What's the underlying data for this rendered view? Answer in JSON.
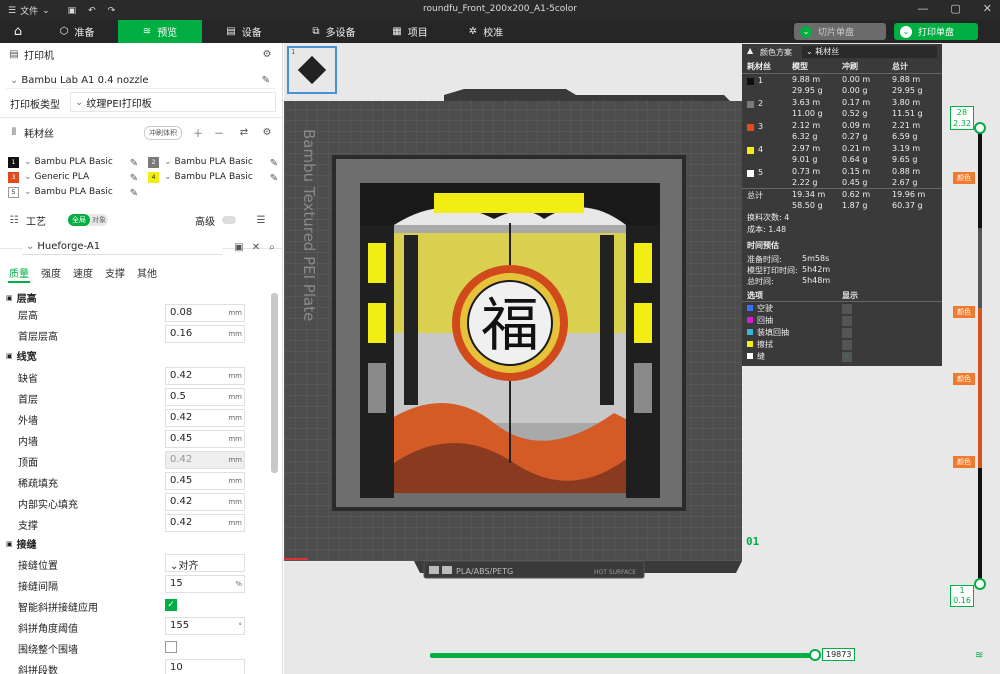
{
  "window": {
    "menu": "文件",
    "title": "roundfu_Front_200x200_A1-5color"
  },
  "tabs": {
    "prepare": "准备",
    "preview": "预览",
    "device": "设备",
    "multi_device": "多设备",
    "project": "项目",
    "calibrate": "校准"
  },
  "actions": {
    "slice": "切片单盘",
    "print": "打印单盘"
  },
  "printer": {
    "header": "打印机",
    "model": "Bambu Lab A1 0.4 nozzle",
    "plate_label": "打印板类型",
    "plate_value": "纹理PEI打印板"
  },
  "filament": {
    "header": "耗材丝",
    "flush_btn": "冲刷体积",
    "items": [
      {
        "num": "1",
        "name": "Bambu PLA Basic",
        "color": "#111111"
      },
      {
        "num": "2",
        "name": "Bambu PLA Basic",
        "color": "#7a7a7a"
      },
      {
        "num": "3",
        "name": "Generic PLA",
        "color": "#e24a1c"
      },
      {
        "num": "4",
        "name": "Bambu PLA Basic",
        "color": "#f2ee14"
      },
      {
        "num": "5",
        "name": "Bambu PLA Basic",
        "color": "#ffffff"
      }
    ]
  },
  "process": {
    "header": "工艺",
    "global": "全局",
    "object": "对象",
    "advanced": "高级",
    "preset": "Hueforge-A1",
    "subtabs": [
      "质量",
      "强度",
      "速度",
      "支撑",
      "其他"
    ]
  },
  "params": {
    "layer_group": "层高",
    "layer_height": {
      "label": "层高",
      "value": "0.08",
      "unit": "mm"
    },
    "first_layer_height": {
      "label": "首层层高",
      "value": "0.16",
      "unit": "mm"
    },
    "width_group": "线宽",
    "default": {
      "label": "缺省",
      "value": "0.42",
      "unit": "mm"
    },
    "first_layer": {
      "label": "首层",
      "value": "0.5",
      "unit": "mm"
    },
    "outer_wall": {
      "label": "外墙",
      "value": "0.42",
      "unit": "mm"
    },
    "inner_wall": {
      "label": "内墙",
      "value": "0.45",
      "unit": "mm"
    },
    "top_surface": {
      "label": "顶面",
      "value": "0.42",
      "unit": "mm"
    },
    "sparse_infill": {
      "label": "稀疏填充",
      "value": "0.45",
      "unit": "mm"
    },
    "internal_solid": {
      "label": "内部实心填充",
      "value": "0.42",
      "unit": "mm"
    },
    "support": {
      "label": "支撑",
      "value": "0.42",
      "unit": "mm"
    },
    "seam_group": "接缝",
    "seam_position": {
      "label": "接缝位置",
      "value": "对齐"
    },
    "seam_gap": {
      "label": "接缝间隔",
      "value": "15",
      "unit": "%"
    },
    "smart_scarf": {
      "label": "智能斜拼接缝应用"
    },
    "scarf_angle": {
      "label": "斜拼角度阈值",
      "value": "155",
      "unit": "°"
    },
    "scarf_around": {
      "label": "围绕整个围墙"
    },
    "scarf_steps": {
      "label": "斜拼段数",
      "value": "10"
    }
  },
  "plate_text": "Bambu Textured PEI Plate",
  "plate_footer": {
    "materials": "PLA/ABS/PETG",
    "hot": "HOT SURFACE"
  },
  "plate_num": "01",
  "plate_thumb": "1",
  "fu_char": "福",
  "stats": {
    "scheme_label": "颜色方案",
    "scheme_value": "耗材丝",
    "headers": [
      "耗材丝",
      "模型",
      "冲刷",
      "总计"
    ],
    "rows": [
      {
        "n": "1",
        "color": "#111111",
        "m1": "9.88 m",
        "g1": "29.95 g",
        "m2": "0.00 m",
        "g2": "0.00 g",
        "m3": "9.88 m",
        "g3": "29.95 g"
      },
      {
        "n": "2",
        "color": "#7a7a7a",
        "m1": "3.63 m",
        "g1": "11.00 g",
        "m2": "0.17 m",
        "g2": "0.52 g",
        "m3": "3.80 m",
        "g3": "11.51 g"
      },
      {
        "n": "3",
        "color": "#e24a1c",
        "m1": "2.12 m",
        "g1": "6.32 g",
        "m2": "0.09 m",
        "g2": "0.27 g",
        "m3": "2.21 m",
        "g3": "6.59 g"
      },
      {
        "n": "4",
        "color": "#f2ee14",
        "m1": "2.97 m",
        "g1": "9.01 g",
        "m2": "0.21 m",
        "g2": "0.64 g",
        "m3": "3.19 m",
        "g3": "9.65 g"
      },
      {
        "n": "5",
        "color": "#ffffff",
        "m1": "0.73 m",
        "g1": "2.22 g",
        "m2": "0.15 m",
        "g2": "0.45 g",
        "m3": "0.88 m",
        "g3": "2.67 g"
      }
    ],
    "total": {
      "label": "总计",
      "m1": "19.34 m",
      "g1": "58.50 g",
      "m2": "0.62 m",
      "g2": "1.87 g",
      "m3": "19.96 m",
      "g3": "60.37 g"
    },
    "changes": "换料次数: 4",
    "cost": "成本: 1.48",
    "time_header": "时间预估",
    "prep_label": "准备时间:",
    "prep_value": "5m58s",
    "model_label": "模型打印时间:",
    "model_value": "5h42m",
    "total_label": "总时间:",
    "total_value": "5h48m",
    "opt_header": "选项",
    "show_header": "显示",
    "options": [
      {
        "name": "空驶",
        "color": "#3d6eff"
      },
      {
        "name": "回抽",
        "color": "#d21ed2"
      },
      {
        "name": "装填回抽",
        "color": "#3ab6d6"
      },
      {
        "name": "擦拭",
        "color": "#f2ee14"
      },
      {
        "name": "缝",
        "color": "#ffffff"
      }
    ]
  },
  "layer_slider": {
    "top_layer": "28",
    "top_height": "2.32",
    "bottom_layer": "1",
    "bottom_height": "0.16",
    "change_label": "颜色"
  },
  "move_slider": {
    "value": "19873"
  }
}
